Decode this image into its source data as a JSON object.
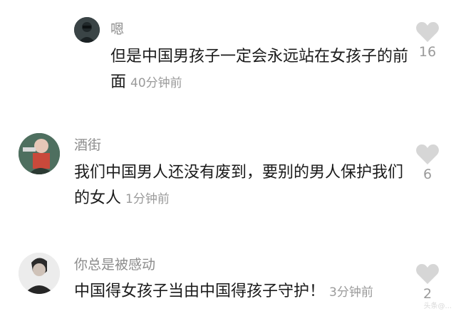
{
  "comments": [
    {
      "username": "嗯",
      "lines": [
        "但是中国男孩子一定会永远站在女孩子的前",
        "面"
      ],
      "time": "40分钟前",
      "likes": "16"
    },
    {
      "username": "酒街",
      "lines": [
        "我们中国男人还没有废到，要别的男人保护我们",
        "的女人"
      ],
      "time": "1分钟前",
      "likes": "6"
    },
    {
      "username": "你总是被感动",
      "lines": [
        "中国得女孩子当由中国得孩子守护！"
      ],
      "time": "3分钟前",
      "likes": "2"
    }
  ],
  "icons": {
    "like": "heart-icon"
  },
  "colors": {
    "heart": "#d6d6d6",
    "username": "#8c8c8c",
    "text": "#1a1a1a",
    "meta": "#9a9a9a"
  },
  "watermark": "头条@..."
}
